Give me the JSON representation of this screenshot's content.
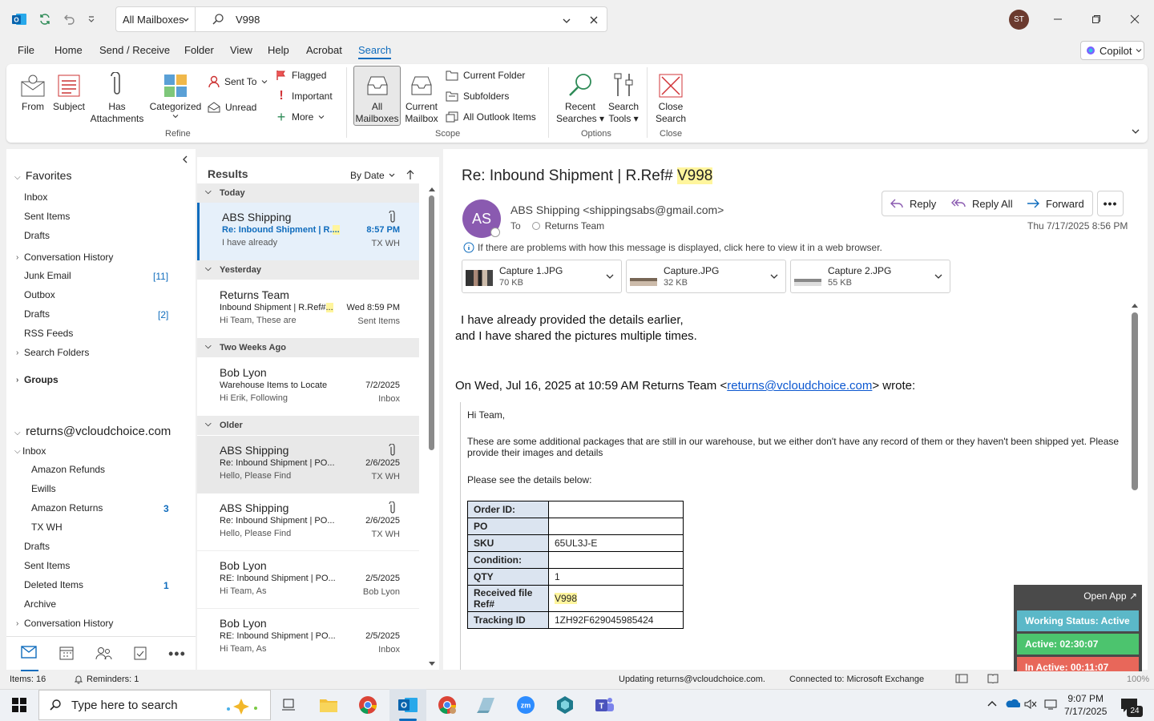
{
  "titlebar": {
    "scope": "All Mailboxes",
    "search_value": "V998",
    "avatar_initials": "ST"
  },
  "menu": {
    "tabs": [
      "File",
      "Home",
      "Send / Receive",
      "Folder",
      "View",
      "Help",
      "Acrobat",
      "Search"
    ],
    "copilot": "Copilot"
  },
  "ribbon": {
    "from": "From",
    "subject": "Subject",
    "has_attachments_1": "Has",
    "has_attachments_2": "Attachments",
    "categorized": "Categorized",
    "sent_to": "Sent To",
    "unread": "Unread",
    "flagged": "Flagged",
    "important": "Important",
    "more": "More",
    "all_mailboxes_1": "All",
    "all_mailboxes_2": "Mailboxes",
    "current_mailbox_1": "Current",
    "current_mailbox_2": "Mailbox",
    "current_folder": "Current Folder",
    "subfolders": "Subfolders",
    "all_outlook_items": "All Outlook Items",
    "recent_searches_1": "Recent",
    "recent_searches_2": "Searches",
    "search_tools_1": "Search",
    "search_tools_2": "Tools",
    "close_search_1": "Close",
    "close_search_2": "Search",
    "groups": {
      "refine": "Refine",
      "scope": "Scope",
      "options": "Options",
      "close": "Close"
    }
  },
  "folders": {
    "favorites": "Favorites",
    "fav_inbox": "Inbox",
    "fav_sent": "Sent Items",
    "fav_drafts": "Drafts",
    "conv_history": "Conversation History",
    "junk": "Junk Email",
    "junk_count": "[11]",
    "outbox": "Outbox",
    "drafts2": "Drafts",
    "drafts2_count": "[2]",
    "rss": "RSS Feeds",
    "search_folders": "Search Folders",
    "groups": "Groups",
    "account": "returns@vcloudchoice.com",
    "inbox": "Inbox",
    "amazon_refunds": "Amazon Refunds",
    "ewills": "Ewills",
    "amazon_returns": "Amazon Returns",
    "amazon_returns_count": "3",
    "txwh": "TX WH",
    "drafts3": "Drafts",
    "sent3": "Sent Items",
    "deleted": "Deleted Items",
    "deleted_count": "1",
    "archive": "Archive",
    "conv_history2": "Conversation History"
  },
  "list": {
    "results": "Results",
    "sort": "By Date",
    "groups": [
      "Today",
      "Yesterday",
      "Two Weeks Ago",
      "Older"
    ],
    "messages": [
      {
        "sender": "ABS Shipping",
        "subject_pre": "Re: Inbound Shipment | R.",
        "subject_hl": "...",
        "preview": "I have already",
        "date": "8:57 PM",
        "folder": "TX WH"
      },
      {
        "sender": "Returns Team",
        "subject_pre": "Inbound Shipment | R.Ref#",
        "subject_hl": "...",
        "preview": "Hi Team,  These are",
        "date": "Wed 8:59 PM",
        "folder": "Sent Items"
      },
      {
        "sender": "Bob Lyon",
        "subject": "Warehouse Items to Locate",
        "preview": "Hi Erik,  Following",
        "date": "7/2/2025",
        "folder": "Inbox"
      },
      {
        "sender": "ABS Shipping",
        "subject": "Re: Inbound Shipment | PO...",
        "preview": "Hello,  Please Find",
        "date": "2/6/2025",
        "folder": "TX WH"
      },
      {
        "sender": "ABS Shipping",
        "subject": "Re: Inbound Shipment | PO...",
        "preview": "Hello,  Please Find",
        "date": "2/6/2025",
        "folder": "TX WH"
      },
      {
        "sender": "Bob Lyon",
        "subject": "RE: Inbound Shipment | PO...",
        "preview": "Hi Team,  As",
        "date": "2/5/2025",
        "folder": "Bob Lyon"
      },
      {
        "sender": "Bob Lyon",
        "subject": "RE: Inbound Shipment | PO...",
        "preview": "Hi Team,  As",
        "date": "2/5/2025",
        "folder": "Inbox"
      }
    ]
  },
  "reading": {
    "subject_pre": "Re: Inbound Shipment | R.Ref# ",
    "subject_hl": "V998",
    "avatar": "AS",
    "from": "ABS Shipping <shippingsabs@gmail.com>",
    "to_label": "To",
    "to": "Returns Team",
    "reply": "Reply",
    "reply_all": "Reply All",
    "forward": "Forward",
    "datetime": "Thu 7/17/2025 8:56 PM",
    "info": "If there are problems with how this message is displayed, click here to view it in a web browser.",
    "attachments": [
      {
        "name": "Capture 1.JPG",
        "size": "70 KB"
      },
      {
        "name": "Capture.JPG",
        "size": "32 KB"
      },
      {
        "name": "Capture 2.JPG",
        "size": "55 KB"
      }
    ],
    "body_line1": "I have already provided the details earlier,",
    "body_line2": "and I have shared the pictures multiple times.",
    "quote_pre": "On Wed, Jul 16, 2025 at 10:59 AM Returns Team <",
    "quote_link": "returns@vcloudchoice.com",
    "quote_post": "> wrote:",
    "q_hi": "Hi Team,",
    "q_para": "These are some additional packages that are still in our warehouse, but we either don't have any record of them or they haven't been shipped yet. Please provide their images and details",
    "q_see": "Please see the details below:",
    "table": [
      {
        "k": "Order ID:",
        "v": ""
      },
      {
        "k": "PO",
        "v": ""
      },
      {
        "k": "SKU",
        "v": "65UL3J-E"
      },
      {
        "k": "Condition:",
        "v": ""
      },
      {
        "k": "QTY",
        "v": "1"
      },
      {
        "k": "Received file Ref#",
        "v": "V998"
      },
      {
        "k": "Tracking ID",
        "v": "1ZH92F629045985424"
      }
    ]
  },
  "widget": {
    "open_app": "Open App",
    "working": "Working Status: Active",
    "active": "Active: 02:30:07",
    "inactive": "In Active: 00:11:07",
    "colors": {
      "working": "#5bb8c8",
      "active": "#4cc46e",
      "inactive": "#e8675a"
    }
  },
  "status": {
    "items": "Items: 16",
    "reminders": "Reminders: 1",
    "updating": "Updating returns@vcloudchoice.com.",
    "connected": "Connected to: Microsoft Exchange",
    "zoom": "100%"
  },
  "taskbar": {
    "search_placeholder": "Type here to search",
    "time": "9:07 PM",
    "date": "7/17/2025",
    "notif": "24"
  },
  "colors": {
    "accent": "#0f6cbd",
    "highlight": "#fff59d"
  }
}
